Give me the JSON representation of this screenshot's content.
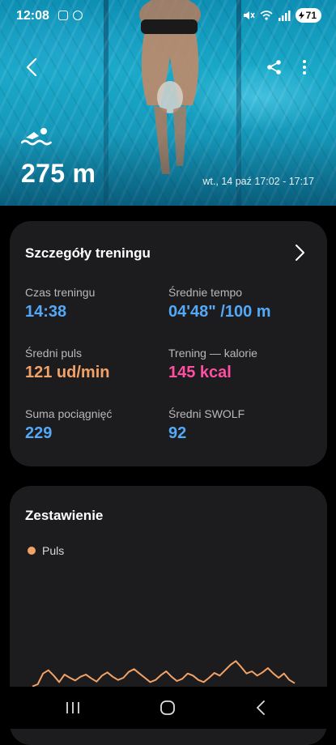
{
  "status": {
    "time": "12:08",
    "battery": "71"
  },
  "workout": {
    "distance": "275 m",
    "date_range": "wt., 14 paź 17:02 - 17:17"
  },
  "details": {
    "title": "Szczegóły treningu",
    "stats": [
      {
        "label": "Czas treningu",
        "value": "14:38"
      },
      {
        "label": "Średnie tempo",
        "value": "04'48\" /100 m"
      },
      {
        "label": "Średni puls",
        "value": "121 ud/min"
      },
      {
        "label": "Trening — kalorie",
        "value": "145 kcal"
      },
      {
        "label": "Suma pociągnięć",
        "value": "229"
      },
      {
        "label": "Średni SWOLF",
        "value": "92"
      }
    ]
  },
  "summary": {
    "title": "Zestawienie",
    "legend": "Puls",
    "legend_color": "#f2a266"
  },
  "chart_data": {
    "type": "line",
    "series": [
      {
        "name": "Puls",
        "values": [
          88,
          92,
          112,
          118,
          108,
          96,
          110,
          104,
          99,
          106,
          110,
          103,
          97,
          108,
          114,
          106,
          100,
          104,
          115,
          120,
          112,
          104,
          96,
          100,
          109,
          116,
          106,
          98,
          102,
          112,
          108,
          100,
          96,
          104,
          113,
          108,
          118,
          128,
          135,
          124,
          112,
          116,
          108,
          114,
          122,
          112,
          104,
          112,
          100,
          94
        ]
      }
    ],
    "xlabel": "",
    "ylabel": ""
  },
  "icons": {
    "back": "chevron-left-icon",
    "share": "share-icon",
    "more": "more-vertical-icon",
    "swim": "swimming-icon",
    "details_chevron": "chevron-right-icon"
  }
}
